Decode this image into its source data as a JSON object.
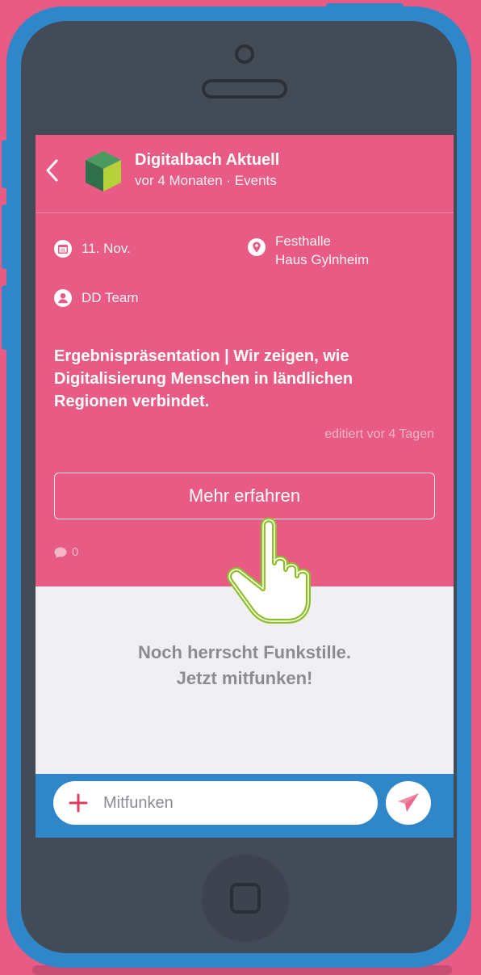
{
  "header": {
    "title": "Digitalbach Aktuell",
    "subtitle": "vor 4 Monaten · Events"
  },
  "event": {
    "date_icon_label": "31",
    "date": "11. Nov.",
    "location_line1": "Festhalle",
    "location_line2": "Haus Gylnheim",
    "organizer": "DD Team",
    "description": "Ergebnispräsentation | Wir zeigen, wie Digitalisierung Menschen in ländlichen Regionen verbindet.",
    "edited": "editiert vor 4 Tagen",
    "more_button": "Mehr erfahren",
    "comment_count": "0"
  },
  "empty_state": {
    "line1": "Noch herrscht Funkstille.",
    "line2": "Jetzt mitfunken!"
  },
  "composer": {
    "placeholder": "Mitfunken"
  },
  "icons": {
    "back": "chevron-left-icon",
    "calendar": "calendar-icon",
    "location": "location-pin-icon",
    "person": "person-icon",
    "comment": "comment-bubble-icon",
    "plus": "plus-icon",
    "send": "paper-plane-icon",
    "pointer": "hand-pointer-icon"
  },
  "colors": {
    "brand_pink": "#e85b85",
    "phone_blue": "#2f87c9",
    "phone_body": "#434b57"
  }
}
